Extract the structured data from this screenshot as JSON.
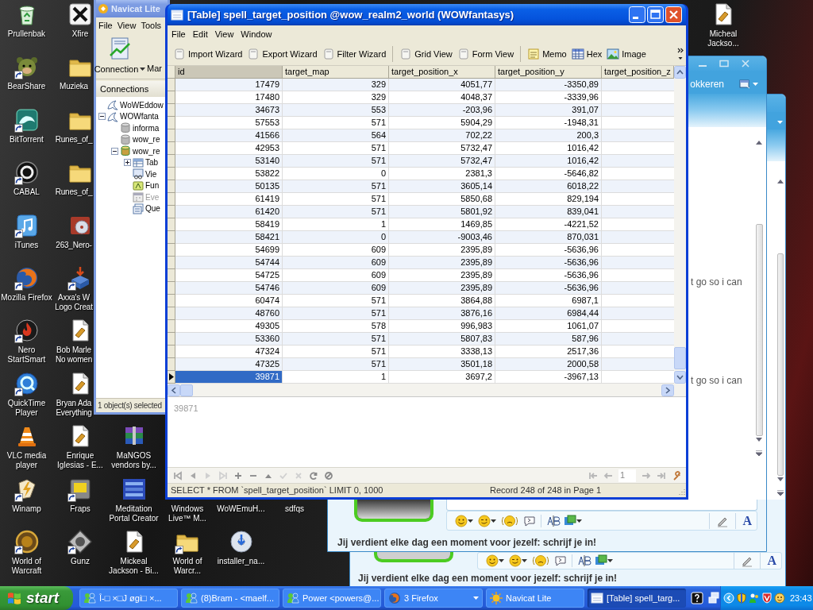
{
  "desktop_icons": [
    {
      "label": [
        "Prullenbak"
      ],
      "kind": "bin",
      "shortcut": false
    },
    {
      "label": [
        "BearShare"
      ],
      "kind": "bear",
      "shortcut": true
    },
    {
      "label": [
        "BitTorrent"
      ],
      "kind": "wave",
      "shortcut": true
    },
    {
      "label": [
        "CABAL"
      ],
      "kind": "ring",
      "shortcut": true
    },
    {
      "label": [
        "iTunes"
      ],
      "kind": "note",
      "shortcut": true
    },
    {
      "label": [
        "Mozilla Firefox"
      ],
      "kind": "globe",
      "shortcut": true
    },
    {
      "label": [
        "Nero",
        "StartSmart"
      ],
      "kind": "flame",
      "shortcut": true
    },
    {
      "label": [
        "QuickTime",
        "Player"
      ],
      "kind": "swirl",
      "shortcut": true
    },
    {
      "label": [
        "VLC media",
        "player"
      ],
      "kind": "cone",
      "shortcut": false
    },
    {
      "label": [
        "Winamp"
      ],
      "kind": "bolt",
      "shortcut": true
    },
    {
      "label": [
        "World of",
        "Warcraft"
      ],
      "kind": "badge",
      "shortcut": true
    },
    {
      "label": [
        "Xfire"
      ],
      "kind": "xlogo",
      "shortcut": false
    },
    {
      "label": [
        "Muzieka"
      ],
      "kind": "folder",
      "shortcut": false
    },
    {
      "label": [
        "Runes_of_"
      ],
      "kind": "folder",
      "shortcut": false
    },
    {
      "label": [
        "Runes_of_"
      ],
      "kind": "folder",
      "shortcut": false
    },
    {
      "label": [
        "263_Nero-"
      ],
      "kind": "disc",
      "shortcut": false
    },
    {
      "label": [
        "Axxa's W",
        "Logo Creat"
      ],
      "kind": "install",
      "shortcut": true
    },
    {
      "label": [
        "Bob Marle",
        "No women"
      ],
      "kind": "media",
      "shortcut": false
    },
    {
      "label": [
        "Bryan Ada",
        "Everything"
      ],
      "kind": "media",
      "shortcut": false
    },
    {
      "label": [
        "Enrique",
        "Iglesias - E..."
      ],
      "kind": "media",
      "shortcut": false
    },
    {
      "label": [
        "Fraps"
      ],
      "kind": "fraps",
      "shortcut": true
    },
    {
      "label": [
        "Gunz"
      ],
      "kind": "diamond",
      "shortcut": true
    },
    {
      "label": [
        "MaNGOS",
        "vendors by..."
      ],
      "kind": "archive",
      "shortcut": false
    },
    {
      "label": [
        "Meditation",
        "Portal Creator"
      ],
      "kind": "tile",
      "shortcut": false
    },
    {
      "label": [
        "Mickeal",
        "Jackson - Bi..."
      ],
      "kind": "media",
      "shortcut": false
    },
    {
      "label": [
        "Windows",
        "Live™ M..."
      ]
    },
    {
      "label": [
        "World of",
        "Warcr..."
      ],
      "kind": "folder",
      "shortcut": true
    },
    {
      "label": [
        "WoWEmuH..."
      ]
    },
    {
      "label": [
        "installer_na..."
      ],
      "kind": "cd",
      "shortcut": false
    },
    {
      "label": [
        "sdfqs"
      ]
    },
    {
      "label": [
        "Micheal",
        "Jackso..."
      ],
      "kind": "media",
      "shortcut": false
    }
  ],
  "navicat_window": {
    "title": "Navicat Lite",
    "menu": [
      "File",
      "View",
      "Tools"
    ],
    "toolbar": {
      "connection": "Connection",
      "next_button": "Mar"
    },
    "panel_title": "Connections",
    "tree": [
      {
        "label": "WoWEddow",
        "kind": "connection"
      },
      {
        "label": "WOWfanta",
        "kind": "connection",
        "expanded": true,
        "children": [
          {
            "label": "informa",
            "kind": "database"
          },
          {
            "label": "wow_re",
            "kind": "database"
          },
          {
            "label": "wow_re",
            "kind": "database",
            "expanded": true,
            "children": [
              {
                "label": "Tab",
                "kind": "tables",
                "expanded": false,
                "disabled": false
              },
              {
                "label": "Vie",
                "kind": "views",
                "disabled": false
              },
              {
                "label": "Fun",
                "kind": "functions",
                "disabled": false
              },
              {
                "label": "Eve",
                "kind": "events",
                "disabled": true
              },
              {
                "label": "Que",
                "kind": "queries",
                "disabled": false
              }
            ]
          }
        ]
      }
    ],
    "status": "1 object(s) selected"
  },
  "table_window": {
    "title": "[Table] spell_target_position @wow_realm2_world (WOWfantasys)",
    "menu": [
      "File",
      "Edit",
      "View",
      "Window"
    ],
    "toolbar": [
      [
        {
          "label": "Import Wizard",
          "kind": "page"
        },
        {
          "label": "Export Wizard",
          "kind": "page"
        },
        {
          "label": "Filter Wizard",
          "kind": "page"
        }
      ],
      [
        {
          "label": "Grid View",
          "kind": "page"
        },
        {
          "label": "Form View",
          "kind": "page"
        }
      ],
      [
        {
          "label": "Memo",
          "kind": "memo"
        },
        {
          "label": "Hex",
          "kind": "hex"
        },
        {
          "label": "Image",
          "kind": "image"
        }
      ]
    ],
    "columns": [
      {
        "label": "id",
        "selected": true
      },
      {
        "label": "target_map",
        "selected": false
      },
      {
        "label": "target_position_x",
        "selected": false
      },
      {
        "label": "target_position_y",
        "selected": false
      },
      {
        "label": "target_position_z",
        "selected": false
      }
    ],
    "rows": [
      {
        "cells": [
          "17479",
          "329",
          "4051,77",
          "-3350,89"
        ],
        "selected": false
      },
      {
        "cells": [
          "17480",
          "329",
          "4048,37",
          "-3339,96"
        ],
        "selected": false
      },
      {
        "cells": [
          "34673",
          "553",
          "-203,96",
          "391,07"
        ],
        "selected": false
      },
      {
        "cells": [
          "57553",
          "571",
          "5904,29",
          "-1948,31"
        ],
        "selected": false
      },
      {
        "cells": [
          "41566",
          "564",
          "702,22",
          "200,3"
        ],
        "selected": false
      },
      {
        "cells": [
          "42953",
          "571",
          "5732,47",
          "1016,42"
        ],
        "selected": false
      },
      {
        "cells": [
          "53140",
          "571",
          "5732,47",
          "1016,42"
        ],
        "selected": false
      },
      {
        "cells": [
          "53822",
          "0",
          "2381,3",
          "-5646,82"
        ],
        "selected": false
      },
      {
        "cells": [
          "50135",
          "571",
          "3605,14",
          "6018,22"
        ],
        "selected": false
      },
      {
        "cells": [
          "61419",
          "571",
          "5850,68",
          "829,194"
        ],
        "selected": false
      },
      {
        "cells": [
          "61420",
          "571",
          "5801,92",
          "839,041"
        ],
        "selected": false
      },
      {
        "cells": [
          "58419",
          "1",
          "1469,85",
          "-4221,52"
        ],
        "selected": false
      },
      {
        "cells": [
          "58421",
          "0",
          "-9003,46",
          "870,031"
        ],
        "selected": false
      },
      {
        "cells": [
          "54699",
          "609",
          "2395,89",
          "-5636,96"
        ],
        "selected": false
      },
      {
        "cells": [
          "54744",
          "609",
          "2395,89",
          "-5636,96"
        ],
        "selected": false
      },
      {
        "cells": [
          "54725",
          "609",
          "2395,89",
          "-5636,96"
        ],
        "selected": false
      },
      {
        "cells": [
          "54746",
          "609",
          "2395,89",
          "-5636,96"
        ],
        "selected": false
      },
      {
        "cells": [
          "60474",
          "571",
          "3864,88",
          "6987,1"
        ],
        "selected": false
      },
      {
        "cells": [
          "48760",
          "571",
          "3876,16",
          "6984,44"
        ],
        "selected": false
      },
      {
        "cells": [
          "49305",
          "578",
          "996,983",
          "1061,07"
        ],
        "selected": false
      },
      {
        "cells": [
          "53360",
          "571",
          "5807,83",
          "587,96"
        ],
        "selected": false
      },
      {
        "cells": [
          "47324",
          "571",
          "3338,13",
          "2517,36"
        ],
        "selected": false
      },
      {
        "cells": [
          "47325",
          "571",
          "3501,18",
          "2000,58"
        ],
        "selected": false
      },
      {
        "cells": [
          "39871",
          "1",
          "3697,2",
          "-3967,13"
        ],
        "selected": true
      }
    ],
    "memo": "39871",
    "page_field": "1",
    "status_sql": "SELECT * FROM `spell_target_position` LIMIT 0, 1000",
    "status_record": "Record 248 of 248 in Page 1"
  },
  "messenger_windows": [
    {
      "toolbar_link": "okkeren",
      "messages": [
        "t go so i can",
        "t go so i can"
      ],
      "ad_text": "Jij verdient elke dag een moment voor jezelf: schrijf je in!",
      "font_button": "A"
    },
    {
      "ad_text": "Jij verdient elke dag een moment voor jezelf: schrijf je in!",
      "font_button": "A"
    }
  ],
  "taskbar": {
    "start": "start",
    "buttons": [
      {
        "label": "Î-□ ×□J øgi□ ×...",
        "kind": "messenger",
        "selected": false
      },
      {
        "label": "(8)Bram - <maelf...",
        "kind": "messenger",
        "selected": false
      },
      {
        "label": "Power <powers@...",
        "kind": "messenger",
        "selected": false
      },
      {
        "label": "3 Firefox",
        "kind": "firefox_group",
        "selected": false
      },
      {
        "label": "Navicat Lite",
        "kind": "navicat",
        "selected": false
      },
      {
        "label": "[Table] spell_targ...",
        "kind": "table",
        "selected": true
      }
    ],
    "clock": "23:43"
  }
}
